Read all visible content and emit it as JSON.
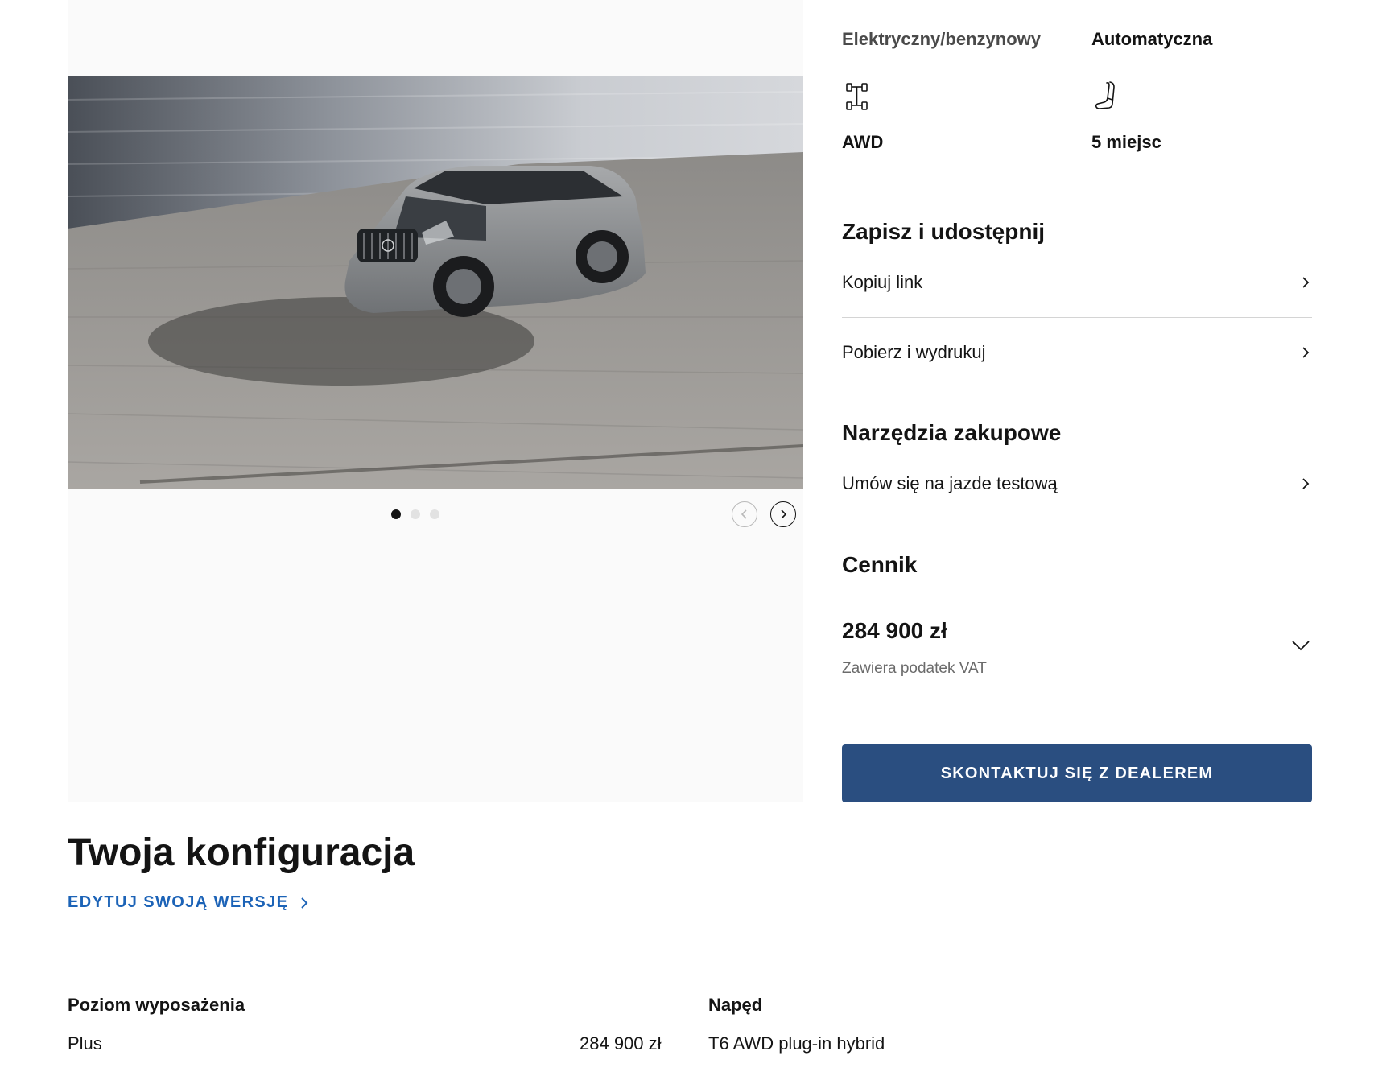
{
  "specs": {
    "fuel": "Elektryczny/benzynowy",
    "transmission": "Automatyczna",
    "drive": "AWD",
    "seats": "5 miejsc"
  },
  "gallery": {
    "slide_count": 3,
    "active_slide": 1
  },
  "save_share": {
    "title": "Zapisz i udostępnij",
    "items": [
      {
        "label": "Kopiuj link"
      },
      {
        "label": "Pobierz i wydrukuj"
      }
    ]
  },
  "tools": {
    "title": "Narzędzia zakupowe",
    "items": [
      {
        "label": "Umów się na jazde testową"
      }
    ]
  },
  "pricing": {
    "title": "Cennik",
    "price": "284 900 zł",
    "vat_note": "Zawiera podatek VAT"
  },
  "cta": {
    "label": "SKONTAKTUJ SIĘ Z DEALEREM"
  },
  "configuration": {
    "title": "Twoja konfiguracja",
    "edit_label": "EDYTUJ SWOJĄ WERSJĘ",
    "trim_heading": "Poziom wyposażenia",
    "trim_value": "Plus",
    "trim_price": "284 900 zł",
    "drive_heading": "Napęd",
    "drive_value": "T6 AWD plug-in hybrid"
  },
  "colors": {
    "cta_background": "#2a4e80",
    "link_accent": "#1c63b7"
  }
}
